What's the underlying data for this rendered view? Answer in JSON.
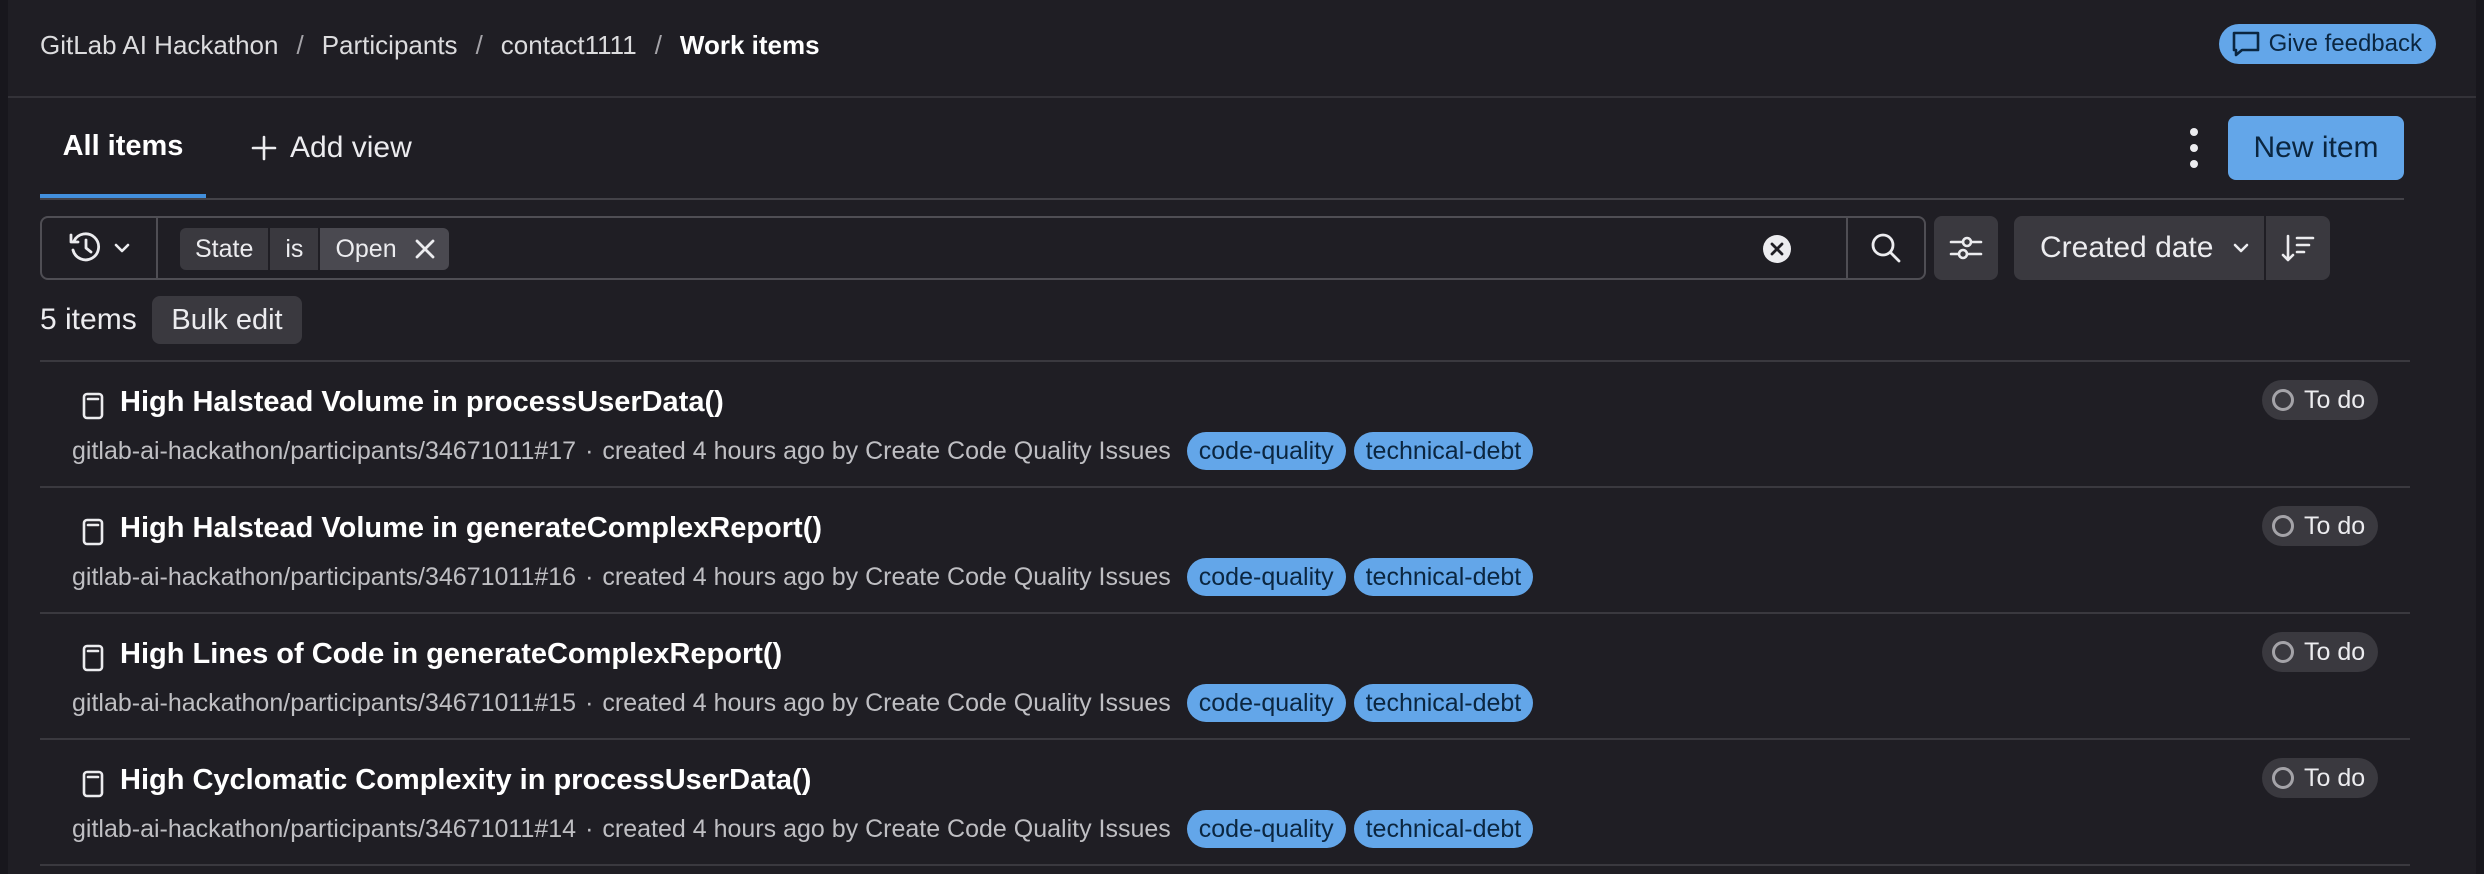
{
  "breadcrumb": {
    "items": [
      "GitLab AI Hackathon",
      "Participants",
      "contact1111"
    ],
    "separator": "/",
    "current": "Work items"
  },
  "feedback_button": {
    "label": "Give feedback"
  },
  "tabs": {
    "all_items": "All items",
    "add_view": "Add view"
  },
  "new_item_button": {
    "label": "New item"
  },
  "filter": {
    "token": {
      "field": "State",
      "operator": "is",
      "value": "Open"
    }
  },
  "sort": {
    "field": "Created date"
  },
  "count_label": "5 items",
  "bulk_edit_label": "Bulk edit",
  "colors": {
    "accent": "#63a6e9",
    "background": "#1f1e24"
  },
  "work_items": [
    {
      "title": "High Halstead Volume in processUserData()",
      "reference": "gitlab-ai-hackathon/participants/34671011#17",
      "created": "created 4 hours ago by Create Code Quality Issues",
      "labels": [
        "code-quality",
        "technical-debt"
      ],
      "status": "To do"
    },
    {
      "title": "High Halstead Volume in generateComplexReport()",
      "reference": "gitlab-ai-hackathon/participants/34671011#16",
      "created": "created 4 hours ago by Create Code Quality Issues",
      "labels": [
        "code-quality",
        "technical-debt"
      ],
      "status": "To do"
    },
    {
      "title": "High Lines of Code in generateComplexReport()",
      "reference": "gitlab-ai-hackathon/participants/34671011#15",
      "created": "created 4 hours ago by Create Code Quality Issues",
      "labels": [
        "code-quality",
        "technical-debt"
      ],
      "status": "To do"
    },
    {
      "title": "High Cyclomatic Complexity in processUserData()",
      "reference": "gitlab-ai-hackathon/participants/34671011#14",
      "created": "created 4 hours ago by Create Code Quality Issues",
      "labels": [
        "code-quality",
        "technical-debt"
      ],
      "status": "To do"
    }
  ]
}
